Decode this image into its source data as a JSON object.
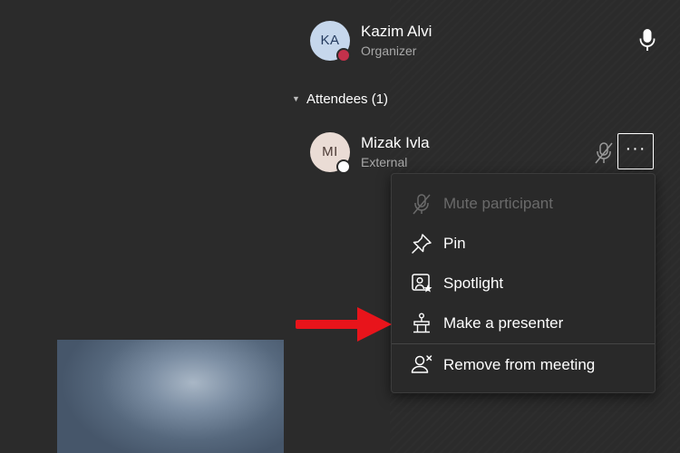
{
  "organizer": {
    "initials": "KA",
    "name": "Kazim Alvi",
    "role": "Organizer",
    "status_color": "#c4314b",
    "icon": "microphone-icon"
  },
  "attendees": {
    "header": "Attendees (1)",
    "list": [
      {
        "initials": "MI",
        "name": "Mizak Ivla",
        "role": "External",
        "icons": [
          "muted-microphone-icon",
          "more-options-icon"
        ],
        "more_label": "···"
      }
    ]
  },
  "context_menu": {
    "items": [
      {
        "label": "Mute participant",
        "icon": "mute-icon",
        "enabled": false
      },
      {
        "label": "Pin",
        "icon": "pin-icon",
        "enabled": true
      },
      {
        "label": "Spotlight",
        "icon": "spotlight-icon",
        "enabled": true
      },
      {
        "label": "Make a presenter",
        "icon": "presenter-icon",
        "enabled": true
      },
      {
        "label": "Remove from meeting",
        "icon": "remove-person-icon",
        "enabled": true
      }
    ]
  },
  "annotation": {
    "arrow_color": "#e8141b",
    "points_to": "Make a presenter"
  },
  "colors": {
    "background": "#2b2b2b",
    "menu": "#292929",
    "muted_text": "#a8a8a8",
    "disabled_text": "#6a6a6a"
  }
}
